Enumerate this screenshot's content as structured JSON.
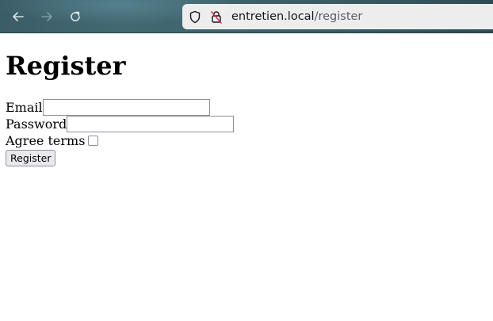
{
  "browser": {
    "url_domain": "entretien.local",
    "url_path": "/register",
    "icons": {
      "back": "arrow-left-icon",
      "forward": "arrow-right-icon",
      "reload": "reload-icon",
      "tracking_protection": "shield-icon",
      "connection": "insecure-lock-icon"
    }
  },
  "page": {
    "title": "Register",
    "form": {
      "email_label": "Email",
      "email_value": "",
      "password_label": "Password",
      "password_value": "",
      "agree_label": "Agree terms",
      "agree_checked": false,
      "submit_label": "Register"
    }
  },
  "colors": {
    "page_background": "#ffffff",
    "urlbar_background": "#ededee",
    "insecure_accent": "#e22850"
  }
}
